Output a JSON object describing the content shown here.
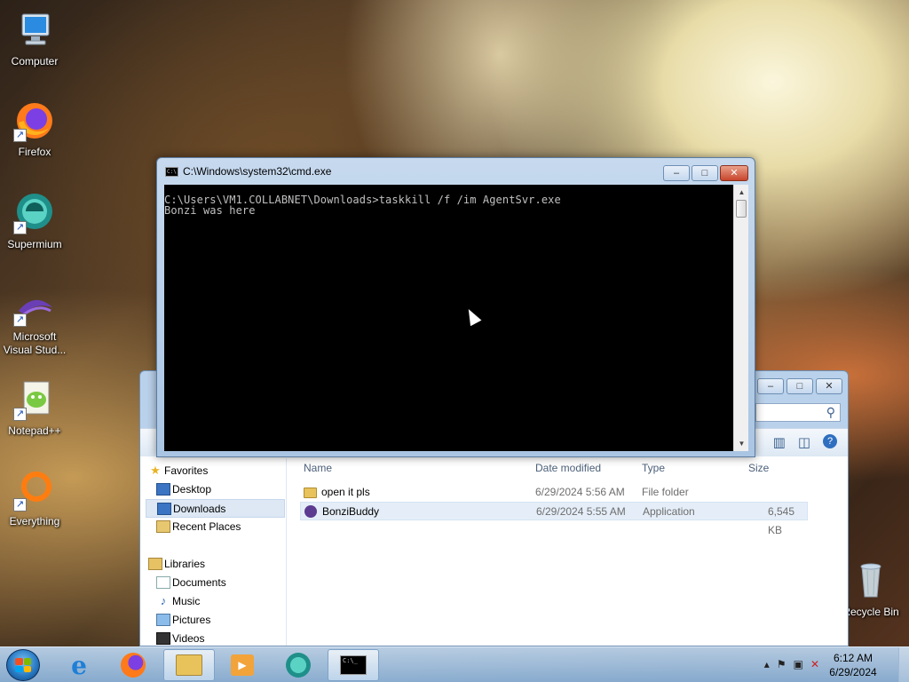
{
  "desktop": {
    "icons": [
      {
        "label": "Computer",
        "icon": "computer-icon"
      },
      {
        "label": "Firefox",
        "icon": "firefox-icon"
      },
      {
        "label": "Supermium",
        "icon": "supermium-icon"
      },
      {
        "label": "Microsoft Visual Stud...",
        "icon": "visual-studio-icon"
      },
      {
        "label": "Notepad++",
        "icon": "notepadpp-icon"
      },
      {
        "label": "Everything",
        "icon": "everything-icon"
      },
      {
        "label": "Recycle Bin",
        "icon": "recycle-bin-icon"
      }
    ]
  },
  "cmd": {
    "title": "C:\\Windows\\system32\\cmd.exe",
    "lines": [
      "C:\\Users\\VM1.COLLABNET\\Downloads>taskkill /f /im AgentSvr.exe",
      "Bonzi was here"
    ],
    "minimize": "–",
    "maximize": "□",
    "close": "✕"
  },
  "explorer": {
    "nav": {
      "favorites": "Favorites",
      "desktop": "Desktop",
      "downloads": "Downloads",
      "recent": "Recent Places",
      "libraries": "Libraries",
      "documents": "Documents",
      "music": "Music",
      "pictures": "Pictures",
      "videos": "Videos"
    },
    "columns": {
      "name": "Name",
      "date": "Date modified",
      "type": "Type",
      "size": "Size"
    },
    "files": [
      {
        "name": "open it pls",
        "date": "6/29/2024 5:56 AM",
        "type": "File folder",
        "size": ""
      },
      {
        "name": "BonziBuddy",
        "date": "6/29/2024 5:55 AM",
        "type": "Application",
        "size": "6,545 KB"
      }
    ]
  },
  "taskbar": {
    "time": "6:12 AM",
    "date": "6/29/2024"
  },
  "colors": {
    "console_bg": "#000000",
    "console_fg": "#c0c0c0",
    "taskbar": "#a9c7e6",
    "selection": "#dde8f4"
  }
}
